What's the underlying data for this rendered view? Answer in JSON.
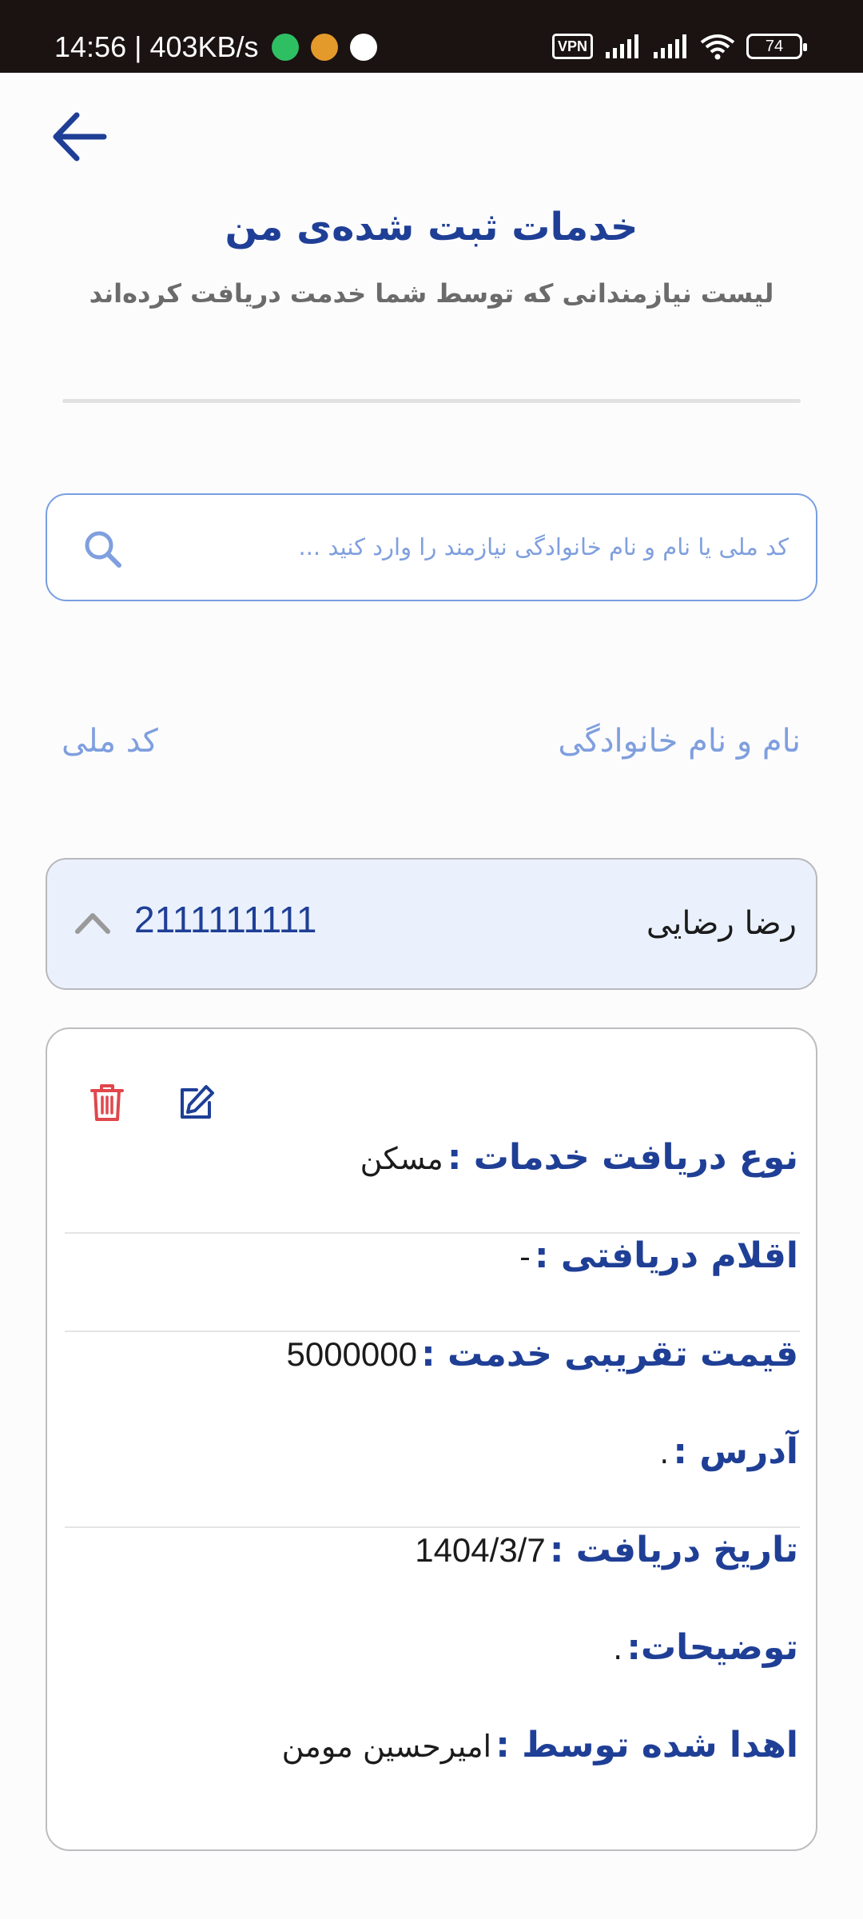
{
  "status_bar": {
    "time_speed": "14:56 | 403KB/s",
    "vpn_label": "VPN",
    "battery": "74"
  },
  "header": {
    "title": "خدمات ثبت شده‌ی من",
    "subtitle": "لیست نیازمندانی که توسط شما خدمت دریافت کرده‌اند"
  },
  "search": {
    "placeholder": "کد ملی یا نام و نام خانوادگی نیازمند را وارد کنید ..."
  },
  "columns": {
    "name": "نام و نام خانوادگی",
    "national_code": "کد ملی"
  },
  "record": {
    "name": "رضا رضایی",
    "national_code": "2111111111",
    "fields": [
      {
        "label": "نوع دریافت خدمات :",
        "value": "مسکن"
      },
      {
        "label": "اقلام دریافتی :",
        "value": "-"
      },
      {
        "label": "قیمت تقریبی خدمت :",
        "value": "5000000"
      },
      {
        "label": "آدرس :",
        "value": "."
      },
      {
        "label": "تاریخ دریافت :",
        "value": "1404/3/7"
      },
      {
        "label": "توضیحات:",
        "value": "."
      },
      {
        "label": "اهدا شده توسط :",
        "value": "امیرحسین مومن"
      }
    ]
  },
  "colors": {
    "primary": "#1f3f96",
    "accent_light": "#7f9fde",
    "row_bg": "#eaf1fd",
    "delete": "#e0474c",
    "status_bar": "#1b1212"
  },
  "icons": [
    "back-arrow-icon",
    "search-icon",
    "chevron-up-icon",
    "trash-icon",
    "edit-icon"
  ]
}
